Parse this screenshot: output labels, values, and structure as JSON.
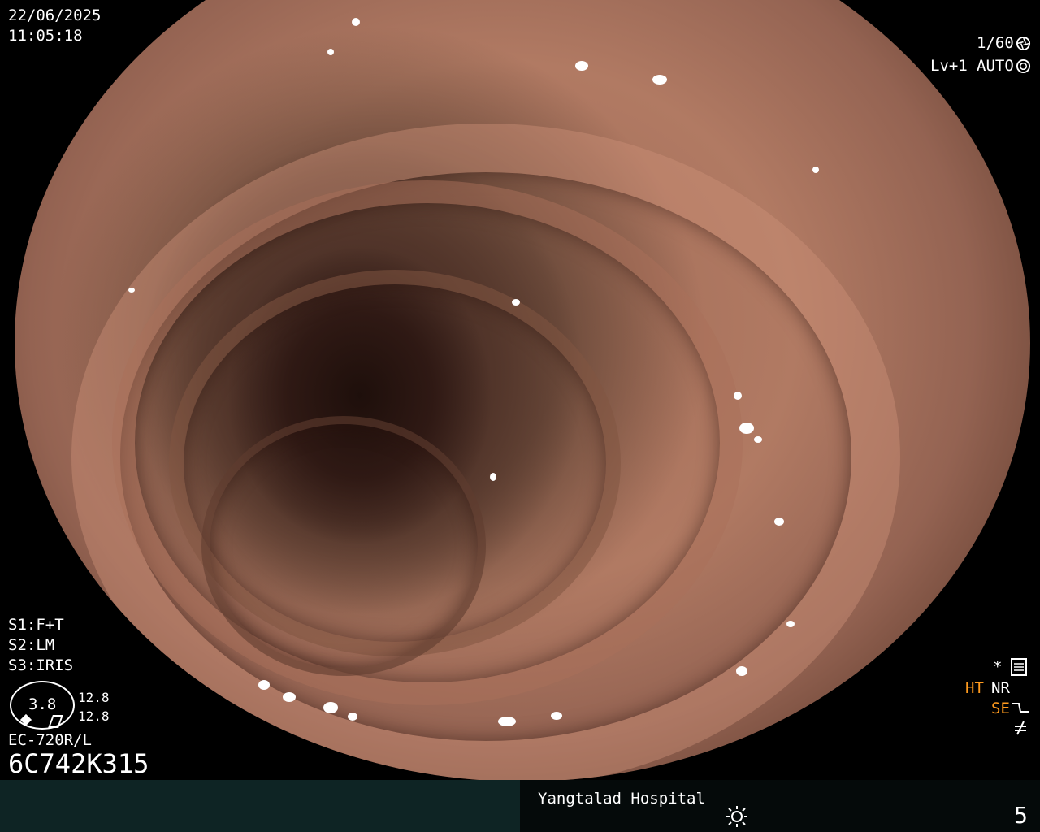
{
  "overlay": {
    "date": "22/06/2025",
    "time": "11:05:18",
    "shutter": "1/60",
    "shutter_icon": "aperture-icon",
    "level": "Lv+1",
    "iris_mode": "AUTO",
    "iris_icon": "iris-icon",
    "s1": "S1:F+T",
    "s2": "S2:LM",
    "s3": "S3:IRIS",
    "gauge_value": "3.8",
    "gauge_scale_1": "12.8",
    "gauge_scale_2": "12.8",
    "scope_model": "EC-720R/L",
    "serial": "6C742K315",
    "mode_ht": "HT",
    "mode_nr": "NR",
    "mode_se": "SE",
    "asterisk": "*",
    "hospital": "Yangtalad Hospital",
    "light_icon": "sun-icon",
    "page_number": "5"
  },
  "colors": {
    "text": "#ffffff",
    "accent_orange": "#ff9a1e",
    "bottom_bar": "#0e2424",
    "background": "#000000"
  }
}
